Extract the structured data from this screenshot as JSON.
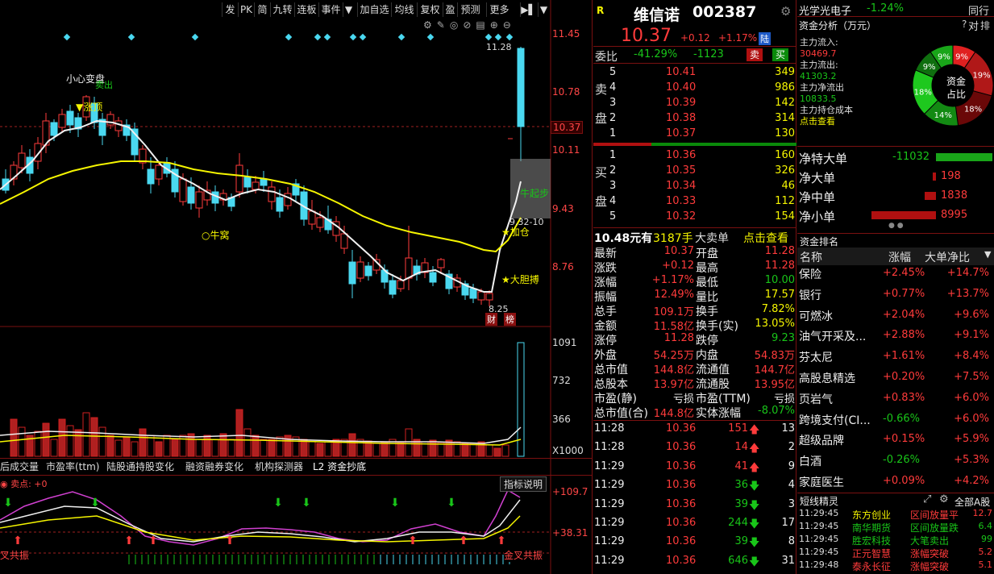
{
  "toolbar": {
    "buttons": [
      "发",
      "PK",
      "简",
      "九转",
      "连板",
      "事件",
      "加自选",
      "均线",
      "复权",
      "盈",
      "预测",
      "更多"
    ]
  },
  "chart": {
    "price_ticks": [
      "11.45",
      "10.78",
      "10.37",
      "10.11",
      "9.43",
      "8.76"
    ],
    "vol_ticks": [
      "1091",
      "732",
      "366",
      "X1000"
    ],
    "macd_ticks": [
      "+109.7",
      "+38.31"
    ],
    "annotations": {
      "xiaoxin": "小心变盘",
      "sell": "卖出",
      "zhangting": "涨顶",
      "niuwo": "牛窝",
      "niuqibu": "牛起步",
      "jiacang": "加仓",
      "dadanbo": "大胆搏",
      "high_mark": "11.28",
      "low_mark": "8.25",
      "range_mark": "9.32-10",
      "cai": "财",
      "bang": "榜"
    },
    "tabs": [
      "后成交量",
      "市盈率(ttm)",
      "陆股通持股变化",
      "融资融券变化",
      "机构探测器",
      "L2 资金抄底"
    ],
    "indicator_label": "卖点: +0",
    "indicator_help": "指标说明",
    "bottom_left": "叉共振",
    "bottom_right": "金叉共振"
  },
  "quote": {
    "name": "维信诺",
    "code": "002387",
    "price": "10.37",
    "change": "+0.12",
    "pct": "+1.17%",
    "tag": "陆",
    "weibi_label": "委比",
    "weibi": "-41.29%",
    "weicha": "-1123",
    "sell_btn": "卖",
    "buy_btn": "买",
    "sell_label": [
      "卖",
      "盘"
    ],
    "buy_label": [
      "买",
      "盘"
    ],
    "asks": [
      [
        "5",
        "10.41",
        "349"
      ],
      [
        "4",
        "10.40",
        "986"
      ],
      [
        "3",
        "10.39",
        "142"
      ],
      [
        "2",
        "10.38",
        "314"
      ],
      [
        "1",
        "10.37",
        "130"
      ]
    ],
    "bids": [
      [
        "1",
        "10.36",
        "160"
      ],
      [
        "2",
        "10.35",
        "326"
      ],
      [
        "3",
        "10.34",
        "46"
      ],
      [
        "4",
        "10.33",
        "112"
      ],
      [
        "5",
        "10.32",
        "154"
      ]
    ],
    "big_order": {
      "price": "10.48元有",
      "qty": "3187手",
      "label": "大卖单",
      "link": "点击查看"
    },
    "stats": [
      [
        "最新",
        "10.37",
        "开盘",
        "11.28"
      ],
      [
        "涨跌",
        "+0.12",
        "最高",
        "11.28"
      ],
      [
        "涨幅",
        "+1.17%",
        "最低",
        "10.00"
      ],
      [
        "振幅",
        "12.49%",
        "量比",
        "17.57"
      ],
      [
        "总手",
        "109.1万",
        "换手",
        "7.82%"
      ],
      [
        "金额",
        "11.58亿",
        "换手(实)",
        "13.05%"
      ],
      [
        "涨停",
        "11.28",
        "跌停",
        "9.23"
      ],
      [
        "外盘",
        "54.25万",
        "内盘",
        "54.83万"
      ],
      [
        "总市值",
        "144.8亿",
        "流通值",
        "144.7亿"
      ],
      [
        "总股本",
        "13.97亿",
        "流通股",
        "13.95亿"
      ],
      [
        "市盈(静)",
        "亏损",
        "市盈(TTM)",
        "亏损"
      ],
      [
        "总市值(合)",
        "144.8亿",
        "实体涨幅",
        "-8.07%"
      ]
    ],
    "ticks": [
      [
        "11:28",
        "10.36",
        "151",
        "13"
      ],
      [
        "11:28",
        "10.36",
        "14",
        "2"
      ],
      [
        "11:29",
        "10.36",
        "41",
        "9"
      ],
      [
        "11:29",
        "10.36",
        "36",
        "4"
      ],
      [
        "11:29",
        "10.36",
        "39",
        "3"
      ],
      [
        "11:29",
        "10.36",
        "244",
        "17"
      ],
      [
        "11:29",
        "10.36",
        "39",
        "8"
      ],
      [
        "11:29",
        "10.36",
        "646",
        "31"
      ]
    ]
  },
  "right": {
    "sector": "光学光电子",
    "sector_pct": "-1.24%",
    "sector_tag": "同行对",
    "fund_title": "资金分析（万元）",
    "fund_q": "?",
    "fund_more": "排",
    "inflow_label": "主力流入:",
    "inflow": "30469.7",
    "outflow_label": "主力流出:",
    "outflow": "41303.2",
    "net_label": "主力净流出",
    "net": "10833.5",
    "cost_label": "主力持仓成本",
    "cost_link": "点击查看",
    "donut_center": [
      "资金",
      "占比"
    ],
    "donut_pcts": [
      "9%",
      "9%",
      "19%",
      "18%",
      "14%",
      "18%",
      "18%"
    ],
    "net_rows": [
      [
        "净特大单",
        "-11032"
      ],
      [
        "净大单",
        "198"
      ],
      [
        "净中单",
        "1838"
      ],
      [
        "净小单",
        "8995"
      ]
    ],
    "rank_title": "资金排名",
    "rank_headers": [
      "名称",
      "涨幅",
      "大单净比"
    ],
    "ranks": [
      [
        "保险",
        "+2.45%",
        "+14.7%"
      ],
      [
        "银行",
        "+0.77%",
        "+13.7%"
      ],
      [
        "可燃冰",
        "+2.04%",
        "+9.6%"
      ],
      [
        "油气开采及...",
        "+2.88%",
        "+9.1%"
      ],
      [
        "芬太尼",
        "+1.61%",
        "+8.4%"
      ],
      [
        "高股息精选",
        "+0.20%",
        "+7.5%"
      ],
      [
        "页岩气",
        "+0.83%",
        "+6.0%"
      ],
      [
        "跨境支付(CI...",
        "-0.66%",
        "+6.0%"
      ],
      [
        "超级品牌",
        "+0.15%",
        "+5.9%"
      ],
      [
        "白酒",
        "-0.26%",
        "+5.3%"
      ],
      [
        "家庭医生",
        "+0.09%",
        "+4.2%"
      ]
    ],
    "short_title": "短线精灵",
    "short_scope": "全部A股",
    "shorts": [
      [
        "11:29:45",
        "东方创业",
        "区间放量平",
        "12.7"
      ],
      [
        "11:29:45",
        "南华期货",
        "区间放量跌",
        "6.4"
      ],
      [
        "11:29:45",
        "胜宏科技",
        "大笔卖出",
        "99"
      ],
      [
        "11:29:45",
        "正元智慧",
        "涨幅突破",
        "5.2"
      ],
      [
        "11:29:48",
        "泰永长征",
        "涨幅突破",
        "5.1"
      ]
    ]
  },
  "colors": {
    "up": "#ff3b3b",
    "down": "#19c519",
    "cyan": "#4ad8f0",
    "yellow": "#f5f500",
    "grid": "#7a1010"
  }
}
